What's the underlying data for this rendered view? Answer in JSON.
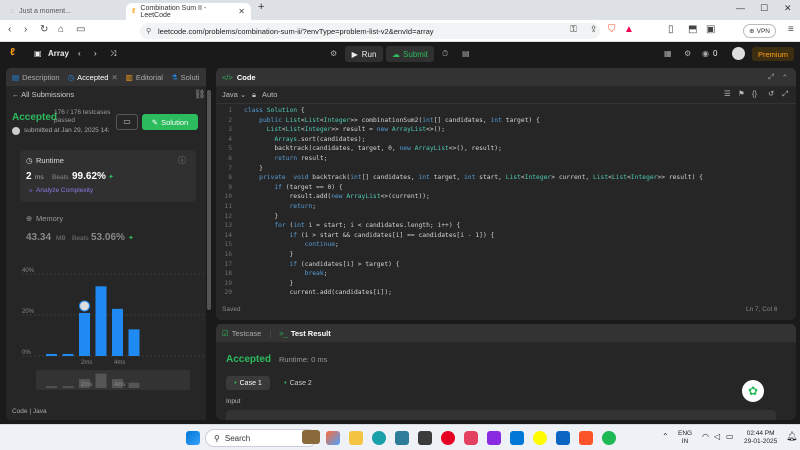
{
  "browser": {
    "inactive_tab": "Just a moment...",
    "active_tab": "Combination Sum II - LeetCode",
    "new_tab": "+",
    "url": "leetcode.com/problems/combination-sum-ii/?envType=problem-list-v2&envId=array",
    "vpn_label": "VPN",
    "minimize": "—",
    "maximize": "☐",
    "close": "✕"
  },
  "lc_nav": {
    "problem_list": "Array",
    "run": "Run",
    "submit": "Submit",
    "coins": "0",
    "premium": "Premium"
  },
  "left_panel": {
    "tabs": [
      "Description",
      "Accepted",
      "Editorial",
      "Soluti"
    ],
    "all_submissions": "All Submissions",
    "status": "Accepted",
    "testcases": "176 / 176 testcases passed",
    "submitted": "submitted at Jan 29, 2025 14:",
    "solution_button": "Solution",
    "runtime_title": "Runtime",
    "runtime_value": "2",
    "runtime_unit": "ms",
    "beats_label": "Beats",
    "runtime_beats": "99.62%",
    "analyze": "Analyze Complexity",
    "memory_title": "Memory",
    "memory_value": "43.34",
    "memory_unit": "MB",
    "memory_beats": "53.06%",
    "bottom_label": "Code  |  Java"
  },
  "chart_data": {
    "type": "bar",
    "y_tick_labels": [
      "40%",
      "20%",
      "0%"
    ],
    "x_tick_labels": [
      "2ms",
      "4ms"
    ],
    "ylim": [
      0,
      40
    ],
    "values": [
      1,
      1,
      21,
      34,
      23,
      13
    ],
    "mini_values": [
      1,
      1,
      5,
      8,
      5,
      3
    ],
    "mini_x_tick_labels": [
      "2ms",
      "4ms"
    ],
    "bar_color": "#1f8bf2"
  },
  "code_panel": {
    "title": "Code",
    "language": "Java",
    "mode": "Auto",
    "status": "Saved",
    "cursor": "Ln 7, Col 6",
    "lines": [
      "class Solution {",
      "    public List<List<Integer>> combinationSum2(int[] candidates, int target) {",
      "      List<List<Integer>> result = new ArrayList<>();",
      "        Arrays.sort(candidates);",
      "        backtrack(candidates, target, 0, new ArrayList<>(), result);",
      "        return result;",
      "    }",
      "    private  void backtrack(int[] candidates, int target, int start, List<Integer> current, List<List<Integer>> result) {",
      "        if (target == 0) {",
      "            result.add(new ArrayList<>(current));",
      "            return;",
      "        }",
      "        for (int i = start; i < candidates.length; i++) {",
      "            if (i > start && candidates[i] == candidates[i - 1]) {",
      "                continue;",
      "            }",
      "            if (candidates[i] > target) {",
      "                break;",
      "            }",
      "            current.add(candidates[i]);"
    ],
    "line_numbers": [
      "1",
      "2",
      "3",
      "4",
      "5",
      "6",
      "7",
      "8",
      "9",
      "10",
      "11",
      "12",
      "13",
      "14",
      "15",
      "16",
      "17",
      "18",
      "19",
      "20"
    ]
  },
  "result_panel": {
    "testcase_tab": "Testcase",
    "result_tab": "Test Result",
    "status": "Accepted",
    "runtime": "Runtime: 0 ms",
    "case1": "Case 1",
    "case2": "Case 2",
    "input_label": "Input"
  },
  "taskbar": {
    "search": "Search",
    "lang_line1": "ENG",
    "lang_line2": "IN",
    "time": "02:44 PM",
    "date": "29-01-2025"
  },
  "colors": {
    "accent_green": "#2cbb5d",
    "accent_blue": "#1f8bf2",
    "premium": "#ffa116"
  }
}
